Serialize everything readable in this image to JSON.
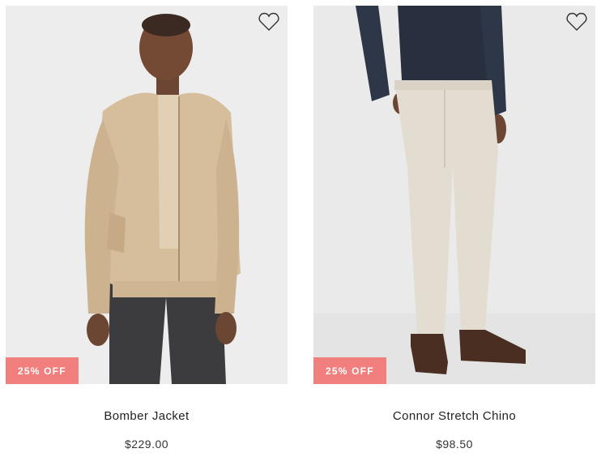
{
  "products": [
    {
      "name": "Bomber Jacket",
      "price": "$229.00",
      "badge": "25% OFF",
      "image_subject": "model in tan bomber jacket"
    },
    {
      "name": "Connor Stretch Chino",
      "price": "$98.50",
      "badge": "25% OFF",
      "image_subject": "model in stone stretch chinos"
    }
  ],
  "icons": {
    "wishlist": "heart-outline-icon"
  },
  "colors": {
    "badge_bg": "#f07f7d",
    "badge_text": "#ffffff"
  }
}
